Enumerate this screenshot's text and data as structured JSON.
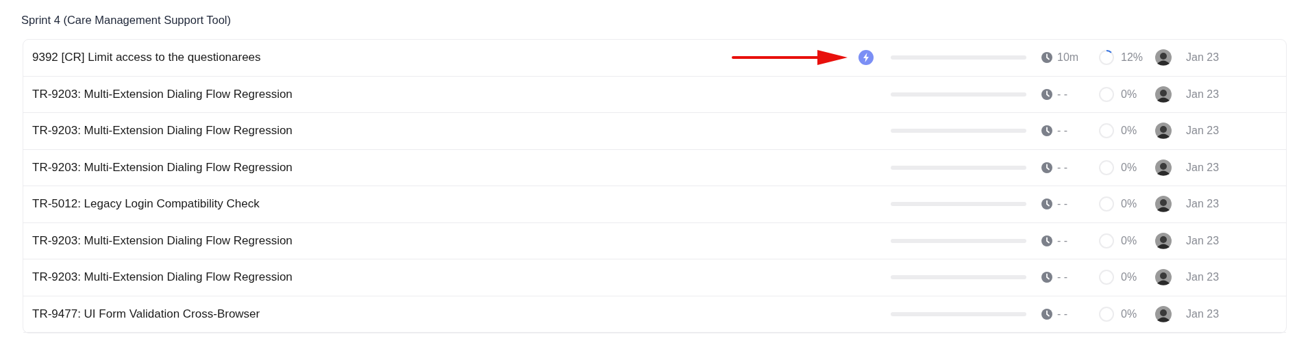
{
  "section": {
    "title": "Sprint 4 (Care Management Support Tool)"
  },
  "rows": [
    {
      "title": "9392 [CR] Limit access to the questionarees",
      "pointer": true,
      "flagged": true,
      "time": "10m",
      "progress": {
        "reading": "12%"
      },
      "date": "Jan 23"
    },
    {
      "title": "TR-9203: Multi-Extension Dialing Flow Regression",
      "pointer": false,
      "flagged": false,
      "time": "- -",
      "progress": {
        "reading": "0%"
      },
      "date": "Jan 23"
    },
    {
      "title": "TR-9203: Multi-Extension Dialing Flow Regression",
      "pointer": false,
      "flagged": false,
      "time": "- -",
      "progress": {
        "reading": "0%"
      },
      "date": "Jan 23"
    },
    {
      "title": "TR-9203: Multi-Extension Dialing Flow Regression",
      "pointer": false,
      "flagged": false,
      "time": "- -",
      "progress": {
        "reading": "0%"
      },
      "date": "Jan 23"
    },
    {
      "title": "TR-5012: Legacy Login Compatibility Check",
      "pointer": false,
      "flagged": false,
      "time": "- -",
      "progress": {
        "reading": "0%"
      },
      "date": "Jan 23"
    },
    {
      "title": "TR-9203: Multi-Extension Dialing Flow Regression",
      "pointer": false,
      "flagged": false,
      "time": "- -",
      "progress": {
        "reading": "0%"
      },
      "date": "Jan 23"
    },
    {
      "title": "TR-9203: Multi-Extension Dialing Flow Regression",
      "pointer": false,
      "flagged": false,
      "time": "- -",
      "progress": {
        "reading": "0%"
      },
      "date": "Jan 23"
    },
    {
      "title": "TR-9477: UI Form Validation Cross-Browser",
      "pointer": false,
      "flagged": false,
      "time": "- -",
      "progress": {
        "reading": "0%"
      },
      "date": "Jan 23"
    }
  ]
}
